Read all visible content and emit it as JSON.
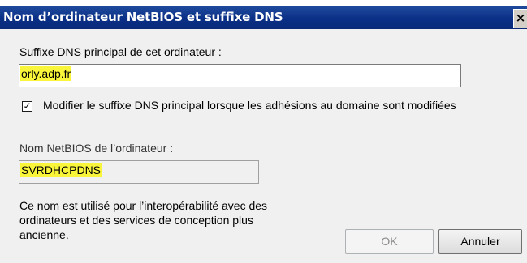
{
  "dialog": {
    "title": "Nom d’ordinateur NetBIOS et suffixe DNS",
    "close_glyph": "×"
  },
  "dns_suffix": {
    "label": "Suffixe DNS principal de cet ordinateur :",
    "value": "orly.adp.fr"
  },
  "modify_checkbox": {
    "checked": true,
    "mark": "✓",
    "label": "Modifier le suffixe DNS principal lorsque les adhésions au domaine sont modifiées"
  },
  "netbios": {
    "label": "Nom NetBIOS de l’ordinateur :",
    "value": "SVRDHCPDNS"
  },
  "info_text": [
    "Ce nom est utilisé pour l’interopérabilité avec des",
    "ordinateurs et des services de conception plus",
    "ancienne."
  ],
  "buttons": {
    "ok": "OK",
    "cancel": "Annuler"
  },
  "colors": {
    "titlebar": "#0a2f86",
    "highlight": "#f9f53a"
  }
}
